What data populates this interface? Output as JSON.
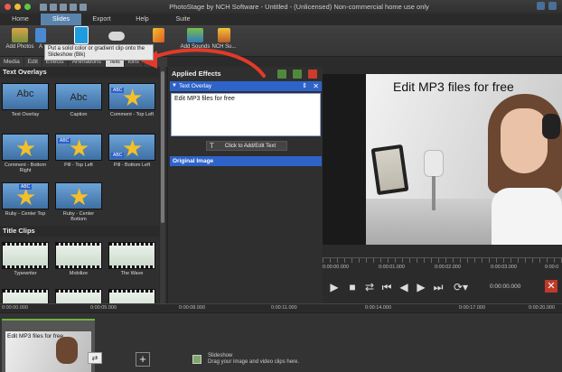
{
  "window": {
    "title": "PhotoStage by NCH Software - Untitled - (Unlicensed) Non-commercial home use only"
  },
  "ribbon_tabs": [
    {
      "label": "Home"
    },
    {
      "label": "Slides",
      "active": true
    },
    {
      "label": "Export"
    },
    {
      "label": "Help"
    },
    {
      "label": "Suite"
    }
  ],
  "ribbon_buttons": [
    {
      "label": "Add Photos",
      "icon": "add-photos-icon"
    },
    {
      "label": "A",
      "icon": "add-audio-icon"
    },
    {
      "label": "Slideshow (Blk)",
      "icon": "blank-slide-icon"
    },
    {
      "label": "",
      "icon": "cloud-icon"
    },
    {
      "label": "",
      "icon": "clip-icon"
    },
    {
      "label": "Add Sounds",
      "icon": "add-sounds-icon"
    },
    {
      "label": "NCH Su...",
      "icon": "nch-suite-icon"
    }
  ],
  "tooltip": {
    "text": "Put a solid color or gradient clip onto the Slideshow (Blk)"
  },
  "left_tabs": [
    {
      "label": "Media"
    },
    {
      "label": "Edit"
    },
    {
      "label": "Effects"
    },
    {
      "label": "Animations"
    },
    {
      "label": "Text",
      "active": true
    },
    {
      "label": "ions"
    }
  ],
  "text_overlays": {
    "heading": "Text Overlays",
    "items": [
      {
        "label": "Text Overlay",
        "style": "abc"
      },
      {
        "label": "Caption",
        "style": "abc"
      },
      {
        "label": "Comment - Top Left",
        "style": "star-badge"
      },
      {
        "label": "Comment - Bottom Right",
        "style": "star"
      },
      {
        "label": "Pill - Top Left",
        "style": "star-badge"
      },
      {
        "label": "Pill - Bottom Left",
        "style": "star-badge"
      },
      {
        "label": "Ruby - Center Top",
        "style": "star-badge"
      },
      {
        "label": "Ruby - Center Bottom",
        "style": "star"
      }
    ]
  },
  "title_clips": {
    "heading": "Title Clips",
    "items": [
      {
        "label": "Typewriter"
      },
      {
        "label": "Mobilize"
      },
      {
        "label": "The Wave"
      }
    ]
  },
  "effects_panel": {
    "heading": "Applied Effects",
    "effect_name": "Text Overlay",
    "text_value": "Edit MP3 files for free",
    "add_text_button": "Click to Add/Edit Text",
    "original_image": "Original Image"
  },
  "preview": {
    "overlay_text": "Edit MP3 files for free",
    "ruler_labels": [
      "0:00:00.000",
      "0:00:01.000",
      "0:00:02.000",
      "0:00:03.000",
      "0:00:0"
    ],
    "current_time": "0:00:00.000"
  },
  "timeline": {
    "ruler_labels": [
      "0:00:00.000",
      "0:00:05.000",
      "0:00:08.000",
      "0:00:11.000",
      "0:00:14.000",
      "0:00:17.000",
      "0:00:20.000"
    ],
    "clip_title": "Edit MP3 files for free",
    "hint_title": "Slideshow",
    "hint_text": "Drag your image and video clips here."
  },
  "colors": {
    "accent": "#2e63c9",
    "tab_active": "#5b84ad",
    "annotation": "#e23a2a"
  }
}
